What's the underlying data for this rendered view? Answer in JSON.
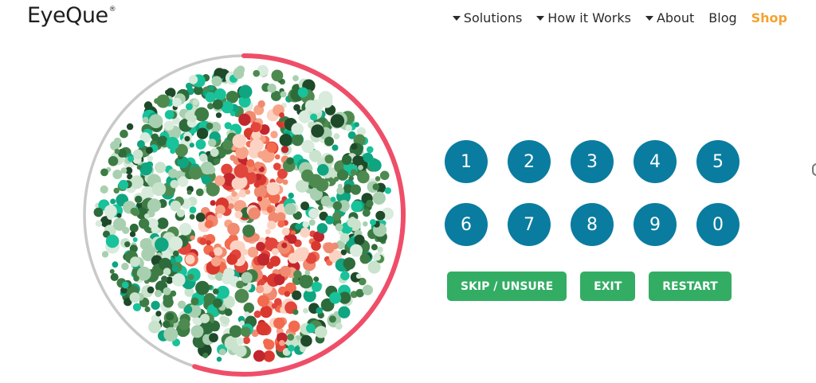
{
  "brand": {
    "name": "EyeQue",
    "mark": "®"
  },
  "nav": {
    "items": [
      {
        "label": "Solutions",
        "dropdown": true
      },
      {
        "label": "How it Works",
        "dropdown": true
      },
      {
        "label": "About",
        "dropdown": true
      },
      {
        "label": "Blog",
        "dropdown": false
      },
      {
        "label": "Shop",
        "dropdown": false
      }
    ],
    "shop_color": "#f5a231"
  },
  "test": {
    "progress": 0.55,
    "progress_color": "#ef4e69",
    "track_color": "#c9c9c9",
    "plate_icon": "ishihara-color-plate"
  },
  "keypad": {
    "keys": [
      "1",
      "2",
      "3",
      "4",
      "5",
      "6",
      "7",
      "8",
      "9",
      "0"
    ],
    "color": "#0a7ca0"
  },
  "actions": {
    "skip": "SKIP / UNSURE",
    "exit": "EXIT",
    "restart": "RESTART",
    "color": "#33ad64"
  }
}
